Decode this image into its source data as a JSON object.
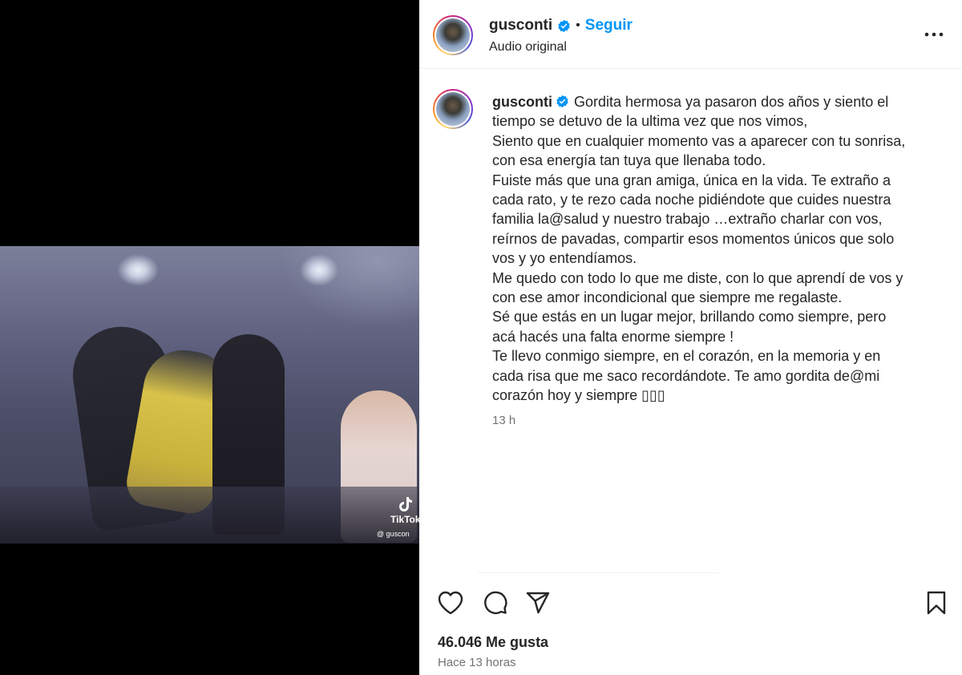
{
  "post": {
    "username": "gusconti",
    "follow_label": "Seguir",
    "separator": "•",
    "audio": "Audio original"
  },
  "media": {
    "watermark_brand": "TikTok",
    "watermark_user": "@ guscon"
  },
  "caption": {
    "username": "gusconti",
    "lines": [
      "Gordita hermosa ya pasaron dos años y siento el",
      "tiempo se detuvo de la ultima vez que nos vimos,",
      "Siento que en cualquier momento vas a aparecer con tu sonrisa,",
      "con esa energía tan tuya que llenaba todo.",
      "Fuiste más que una gran amiga, única en la vida. Te extraño a",
      "cada rato, y te rezo cada noche pidiéndote que cuides nuestra",
      "familia la@salud y nuestro trabajo …extraño charlar con vos,",
      "reírnos de pavadas, compartir esos momentos únicos que solo",
      "vos y yo entendíamos.",
      "Me quedo con todo lo que me diste, con lo que aprendí de vos y",
      "con ese amor incondicional que siempre me regalaste.",
      "Sé que estás en un lugar mejor, brillando como siempre, pero",
      "acá hacés una falta enorme siempre !",
      "Te llevo conmigo siempre, en el corazón, en la memoria y en",
      "cada risa que me saco recordándote. Te amo gordita de@mi",
      "corazón hoy y siempre ▯▯▯"
    ],
    "relative_time": "13 h"
  },
  "footer": {
    "likes": "46.046 Me gusta",
    "timestamp": "Hace 13 horas"
  },
  "icons": {
    "verified": "verified-badge-icon",
    "more": "more-options-icon",
    "like": "heart-icon",
    "comment": "comment-icon",
    "share": "share-icon",
    "save": "bookmark-icon"
  },
  "colors": {
    "accent": "#0095f6",
    "text": "#262626",
    "muted": "#737373",
    "media_bg": "#000000"
  }
}
